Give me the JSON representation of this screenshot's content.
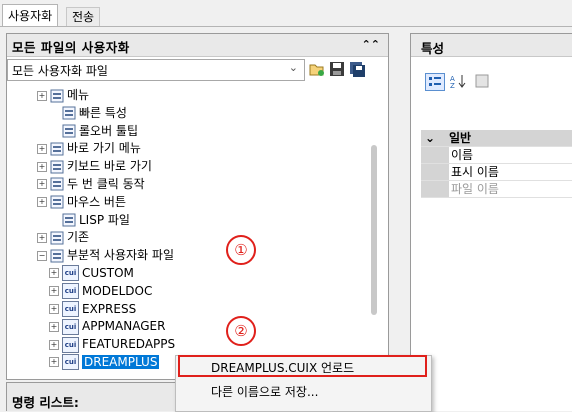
{
  "tabs": [
    "사용자화",
    "전송"
  ],
  "left_panel": {
    "title": "모든 파일의 사용자화",
    "collapse_icon": "chevron-double-up",
    "dropdown_value": "모든 사용자화 파일",
    "tree": [
      {
        "label": "메뉴",
        "indent": 0,
        "expand": "+"
      },
      {
        "label": "빠른 특성",
        "indent": 1,
        "expand": ""
      },
      {
        "label": "롤오버 툴팁",
        "indent": 1,
        "expand": ""
      },
      {
        "label": "바로 가기 메뉴",
        "indent": 0,
        "expand": "+"
      },
      {
        "label": "키보드 바로 가기",
        "indent": 0,
        "expand": "+"
      },
      {
        "label": "두 번 클릭 동작",
        "indent": 0,
        "expand": "+"
      },
      {
        "label": "마우스 버튼",
        "indent": 0,
        "expand": "+"
      },
      {
        "label": "LISP 파일",
        "indent": 1,
        "expand": ""
      },
      {
        "label": "기존",
        "indent": 0,
        "expand": "+"
      },
      {
        "label": "부분적 사용자화 파일",
        "indent": 0,
        "expand": "-"
      },
      {
        "label": "CUSTOM",
        "indent": 1,
        "expand": "+"
      },
      {
        "label": "MODELDOC",
        "indent": 1,
        "expand": "+"
      },
      {
        "label": "EXPRESS",
        "indent": 1,
        "expand": "+"
      },
      {
        "label": "APPMANAGER",
        "indent": 1,
        "expand": "+"
      },
      {
        "label": "FEATUREDAPPS",
        "indent": 1,
        "expand": "+"
      },
      {
        "label": "DREAMPLUS",
        "indent": 1,
        "expand": "+"
      }
    ]
  },
  "bottom_panel": {
    "title": "명령 리스트:"
  },
  "right_panel": {
    "title": "특성",
    "group": "일반",
    "rows": [
      "이름",
      "표시 이름",
      "파일 이름"
    ]
  },
  "context_menu": {
    "items": [
      "DREAMPLUS.CUIX 언로드",
      "다른 이름으로 저장..."
    ]
  },
  "annotations": [
    "①",
    "②"
  ]
}
